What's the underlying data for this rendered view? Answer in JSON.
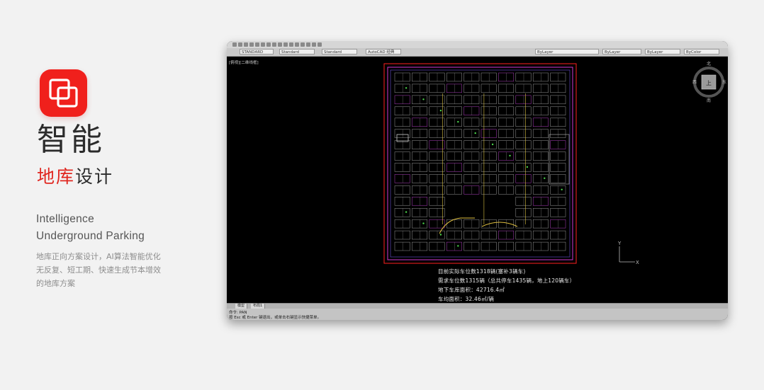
{
  "hero": {
    "title_main": "智能",
    "title_sub_accent": "地库",
    "title_sub_rest": "设计",
    "en_line1": "Intelligence",
    "en_line2": "Underground Parking",
    "description": "地库正向方案设计，AI算法智能优化 无反复、短工期、快速生成节本增效的地库方案"
  },
  "cad_window": {
    "viewport_label": "[俯视][二维线框]",
    "toolbar_fields": [
      "STANDARD",
      "Standard",
      "Standard",
      "AutoCAD 经典",
      "ByLayer",
      "ByLayer",
      "ByLayer",
      "ByColor"
    ],
    "info_lines": [
      "目前实际车位数1318辆(塞补3辆车)",
      "需求车位数1315辆（总共停车1435辆，地上120辆车）",
      "地下车库面积：42716.4㎡",
      "车均面积：32.46㎡/辆"
    ],
    "compass": {
      "n": "北",
      "s": "南",
      "e": "东",
      "w": "西",
      "center": "上"
    },
    "axis": {
      "y": "Y",
      "x": "X"
    },
    "layout_tabs": [
      "模型",
      "布局1"
    ],
    "command_lines": [
      "命令: PAN",
      "按 Esc 或 Enter 键退出，或单击右键显示快捷菜单。"
    ]
  }
}
